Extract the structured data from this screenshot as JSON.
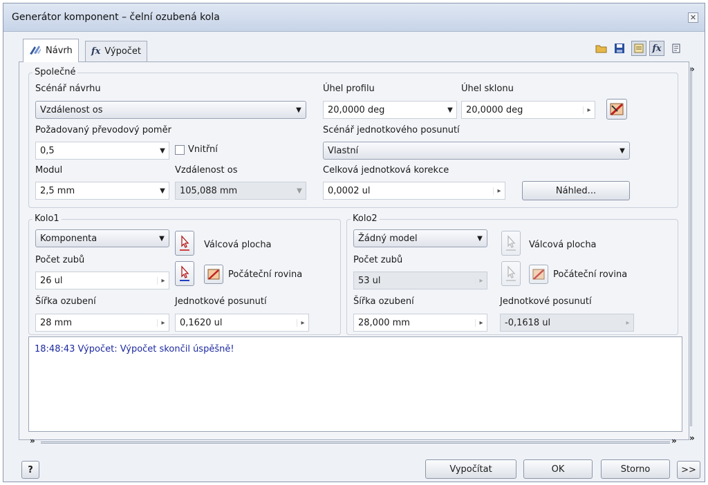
{
  "window": {
    "title": "Generátor komponent – čelní ozubená kola"
  },
  "tabs": [
    {
      "label": "Návrh",
      "icon": "design-icon",
      "active": true
    },
    {
      "label": "Výpočet",
      "icon": "fx-calculation-icon",
      "active": false
    }
  ],
  "toolbar": {
    "icons": [
      "open-folder-icon",
      "save-icon",
      "catalog-icon",
      "fx-calculation-icon",
      "notes-icon"
    ],
    "fx_glyph": "fx"
  },
  "spolecne": {
    "group_label": "Společné",
    "design_scenario": {
      "label": "Scénář návrhu",
      "value": "Vzdálenost os"
    },
    "profile_angle": {
      "label": "Úhel profilu",
      "value": "20,0000 deg"
    },
    "helix_angle": {
      "label": "Úhel sklonu",
      "value": "20,0000 deg"
    },
    "ratio": {
      "label": "Požadovaný převodový poměr",
      "value": "0,5"
    },
    "internal": {
      "label": "Vnitřní",
      "checked": false
    },
    "shift_scenario": {
      "label": "Scénář jednotkového posunutí",
      "value": "Vlastní"
    },
    "module": {
      "label": "Modul",
      "value": "2,5 mm"
    },
    "center_distance": {
      "label": "Vzdálenost os",
      "value": "105,088 mm"
    },
    "total_correction": {
      "label": "Celková jednotková korekce",
      "value": "0,0002 ul"
    },
    "preview_button": "Náhled..."
  },
  "kolo1": {
    "group_label": "Kolo1",
    "type": "Komponenta",
    "cylindrical_face": "Válcová plocha",
    "start_plane": "Počáteční rovina",
    "teeth": {
      "label": "Počet zubů",
      "value": "26 ul"
    },
    "width": {
      "label": "Šířka ozubení",
      "value": "28 mm"
    },
    "shift": {
      "label": "Jednotkové posunutí",
      "value": "0,1620 ul"
    }
  },
  "kolo2": {
    "group_label": "Kolo2",
    "type": "Žádný model",
    "cylindrical_face": "Válcová plocha",
    "start_plane": "Počáteční rovina",
    "teeth": {
      "label": "Počet zubů",
      "value": "53 ul"
    },
    "width": {
      "label": "Šířka ozubení",
      "value": "28,000 mm"
    },
    "shift": {
      "label": "Jednotkové posunutí",
      "value": "-0,1618 ul"
    }
  },
  "log": {
    "lines": [
      "18:48:43 Výpočet: Výpočet skončil úspěšně!"
    ]
  },
  "buttons": {
    "help": "?",
    "calculate": "Vypočítat",
    "ok": "OK",
    "cancel": "Storno",
    "more": ">>"
  },
  "colors": {
    "log_text": "#1d2aa0",
    "window_bg": "#eef1f6",
    "title_bg": "#c7d4e8"
  }
}
